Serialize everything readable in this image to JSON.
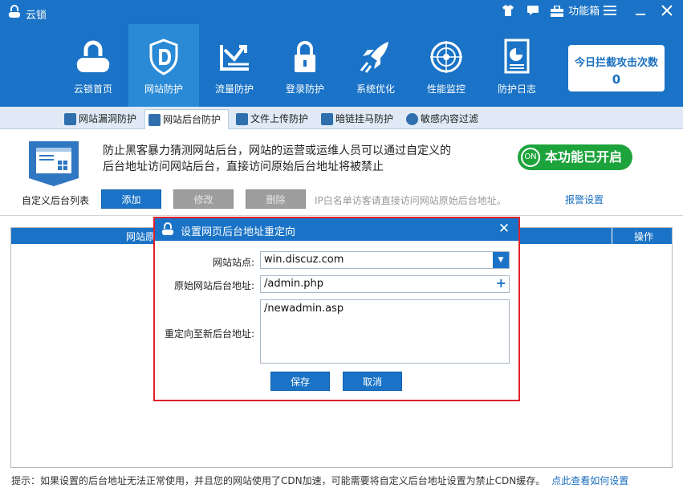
{
  "app": {
    "title": "云锁",
    "function_box": "功能箱"
  },
  "nav": {
    "items": [
      {
        "label": "云锁首页"
      },
      {
        "label": "网站防护"
      },
      {
        "label": "流量防护"
      },
      {
        "label": "登录防护"
      },
      {
        "label": "系统优化"
      },
      {
        "label": "性能监控"
      },
      {
        "label": "防护日志"
      }
    ],
    "active_index": 1
  },
  "counter": {
    "title": "今日拦截攻击次数",
    "value": "0"
  },
  "subtabs": [
    {
      "label": "网站漏洞防护"
    },
    {
      "label": "网站后台防护"
    },
    {
      "label": "文件上传防护"
    },
    {
      "label": "暗链挂马防护"
    },
    {
      "label": "敏感内容过滤"
    }
  ],
  "info": {
    "line1": "防止黑客暴力猜测网站后台，网站的运营或运维人员可以通过自定义的",
    "line2": "后台地址访问网站后台，直接访问原始后台地址将被禁止",
    "toggle_knob": "ON",
    "toggle_label": "本功能已开启"
  },
  "toolbar": {
    "list_label": "自定义后台列表",
    "add": "添加",
    "edit": "修改",
    "delete": "删除",
    "hint": "IP白名单访客请直接访问网站原始后台地址。",
    "alarm": "报警设置"
  },
  "table": {
    "col_site": "网站原",
    "col_action": "操作"
  },
  "footer": {
    "tip": "提示：如果设置的后台地址无法正常使用，并且您的网站使用了CDN加速，可能需要将自定义后台地址设置为禁止CDN缓存。",
    "link": "点此查看如何设置"
  },
  "dialog": {
    "title": "设置网页后台地址重定向",
    "site_label": "网站站点:",
    "site_value": "win.discuz.com",
    "orig_label": "原始网站后台地址:",
    "orig_value": "/admin.php",
    "new_label": "重定向至新后台地址:",
    "new_value": "/newadmin.asp",
    "save": "保存",
    "cancel": "取消"
  },
  "colors": {
    "header": "#1a73c6",
    "active_nav": "#2a8ad6",
    "toggle_on": "#1da33c",
    "dialog_border": "#e0222c"
  }
}
